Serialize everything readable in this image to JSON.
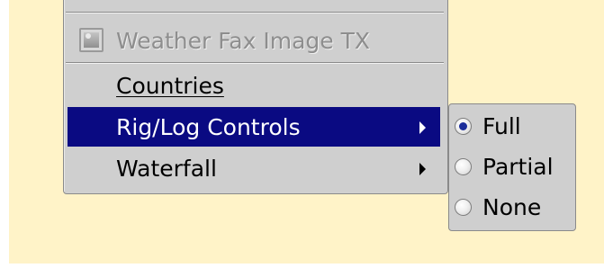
{
  "menu": {
    "items": [
      {
        "label": "Weather Fax Image TX",
        "enabled": false,
        "icon": "image-icon"
      },
      {
        "label": "Countries",
        "enabled": true,
        "mnemonic": "o"
      },
      {
        "label": "Rig/Log Controls",
        "enabled": true,
        "selected": true,
        "has_submenu": true
      },
      {
        "label": "Waterfall",
        "enabled": true,
        "has_submenu": true
      }
    ]
  },
  "submenu": {
    "items": [
      {
        "label": "Full",
        "checked": true
      },
      {
        "label": "Partial",
        "checked": false
      },
      {
        "label": "None",
        "checked": false
      }
    ]
  },
  "colors": {
    "background": "#fff3c8",
    "menu": "#cfcfcf",
    "highlight": "#0a0a82"
  }
}
